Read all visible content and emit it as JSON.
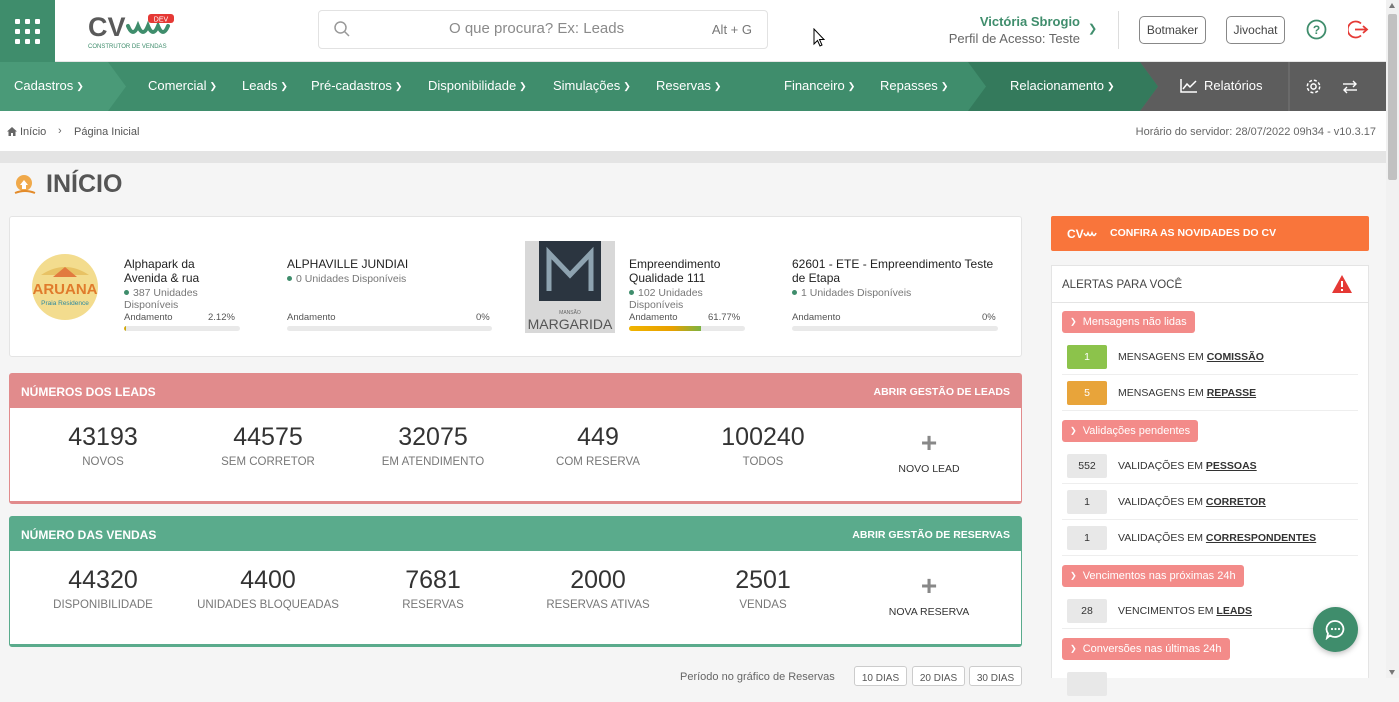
{
  "header": {
    "logo_text": "CV",
    "logo_badge": "DEV",
    "logo_subtitle": "CONSTRUTOR DE VENDAS",
    "search_placeholder": "O que procura? Ex: Leads",
    "search_shortcut": "Alt + G",
    "user_name": "Victória Sbrogio",
    "user_profile": "Perfil de Acesso: Teste",
    "btn_botmaker": "Botmaker",
    "btn_jivochat": "Jivochat",
    "icons": [
      "apps-grid-icon",
      "search-icon",
      "help-icon",
      "logout-icon"
    ]
  },
  "nav": {
    "items": [
      "Cadastros",
      "Comercial",
      "Leads",
      "Pré-cadastros",
      "Disponibilidade",
      "Simulações",
      "Reservas",
      "Financeiro",
      "Repasses",
      "Relacionamento",
      "Relatórios"
    ],
    "colors": {
      "base": "#3f8d6c",
      "light": "#4a9a78",
      "dark": "#347a5c",
      "gray": "#5d5d5d"
    }
  },
  "breadcrumb": {
    "home": "Início",
    "current": "Página Inicial",
    "server_time": "Horário do servidor: 28/07/2022 09h34 - v10.3.17"
  },
  "page": {
    "title": "INÍCIO"
  },
  "empreendimentos": [
    {
      "name": "Alphapark da Avenida & rua",
      "units": "387 Unidades Disponíveis",
      "progress_label": "Andamento",
      "progress": "2.12%",
      "progress_value": 2.12,
      "logo_text": "ARUANA",
      "logo_sub": "Praia Residence"
    },
    {
      "name": "ALPHAVILLE JUNDIAI",
      "units": "0 Unidades Disponíveis",
      "progress_label": "Andamento",
      "progress": "0%",
      "progress_value": 0
    },
    {
      "name": "Empreendimento Qualidade 111",
      "units": "102 Unidades Disponíveis",
      "progress_label": "Andamento",
      "progress": "61.77%",
      "progress_value": 61.77,
      "logo_text": "MARGARIDA",
      "logo_sub": "MANSÃO"
    },
    {
      "name": "62601 - ETE - Empreendimento Teste de Etapa",
      "units": "1 Unidades Disponíveis",
      "progress_label": "Andamento",
      "progress": "0%",
      "progress_value": 0
    }
  ],
  "leads_panel": {
    "title": "NÚMEROS DOS LEADS",
    "action": "ABRIR GESTÃO DE LEADS",
    "color": "#e18b8c",
    "stats": [
      {
        "value": "43193",
        "label": "NOVOS"
      },
      {
        "value": "44575",
        "label": "SEM CORRETOR"
      },
      {
        "value": "32075",
        "label": "EM ATENDIMENTO"
      },
      {
        "value": "449",
        "label": "COM RESERVA"
      },
      {
        "value": "100240",
        "label": "TODOS"
      }
    ],
    "add_label": "NOVO LEAD"
  },
  "sales_panel": {
    "title": "NÚMERO DAS VENDAS",
    "action": "ABRIR GESTÃO DE RESERVAS",
    "color": "#5aab8c",
    "stats": [
      {
        "value": "44320",
        "label": "DISPONIBILIDADE"
      },
      {
        "value": "4400",
        "label": "UNIDADES BLOQUEADAS"
      },
      {
        "value": "7681",
        "label": "RESERVAS"
      },
      {
        "value": "2000",
        "label": "RESERVAS ATIVAS"
      },
      {
        "value": "2501",
        "label": "VENDAS"
      }
    ],
    "add_label": "NOVA RESERVA"
  },
  "period": {
    "label": "Período no gráfico de Reservas",
    "buttons": [
      "10 DIAS",
      "20 DIAS",
      "30 DIAS"
    ]
  },
  "novidades": {
    "text": "CONFIRA AS NOVIDADES DO CV",
    "color": "#f9753b"
  },
  "alerts": {
    "title": "ALERTAS PARA VOCÊ",
    "groups": [
      {
        "tag": "Mensagens não lidas",
        "rows": [
          {
            "count": "1",
            "prefix": "MENSAGENS EM ",
            "link": "COMISSÃO",
            "color": "#8cc34b"
          },
          {
            "count": "5",
            "prefix": "MENSAGENS EM ",
            "link": "REPASSE",
            "color": "#e8a43a"
          }
        ]
      },
      {
        "tag": "Validações pendentes",
        "rows": [
          {
            "count": "552",
            "prefix": "VALIDAÇÕES EM ",
            "link": "PESSOAS"
          },
          {
            "count": "1",
            "prefix": "VALIDAÇÕES EM ",
            "link": "CORRETOR"
          },
          {
            "count": "1",
            "prefix": "VALIDAÇÕES EM ",
            "link": "CORRESPONDENTES"
          }
        ]
      },
      {
        "tag": "Vencimentos nas próximas 24h",
        "rows": [
          {
            "count": "28",
            "prefix": "VENCIMENTOS EM ",
            "link": "LEADS"
          }
        ]
      },
      {
        "tag": "Conversões nas últimas 24h",
        "rows": []
      }
    ]
  }
}
